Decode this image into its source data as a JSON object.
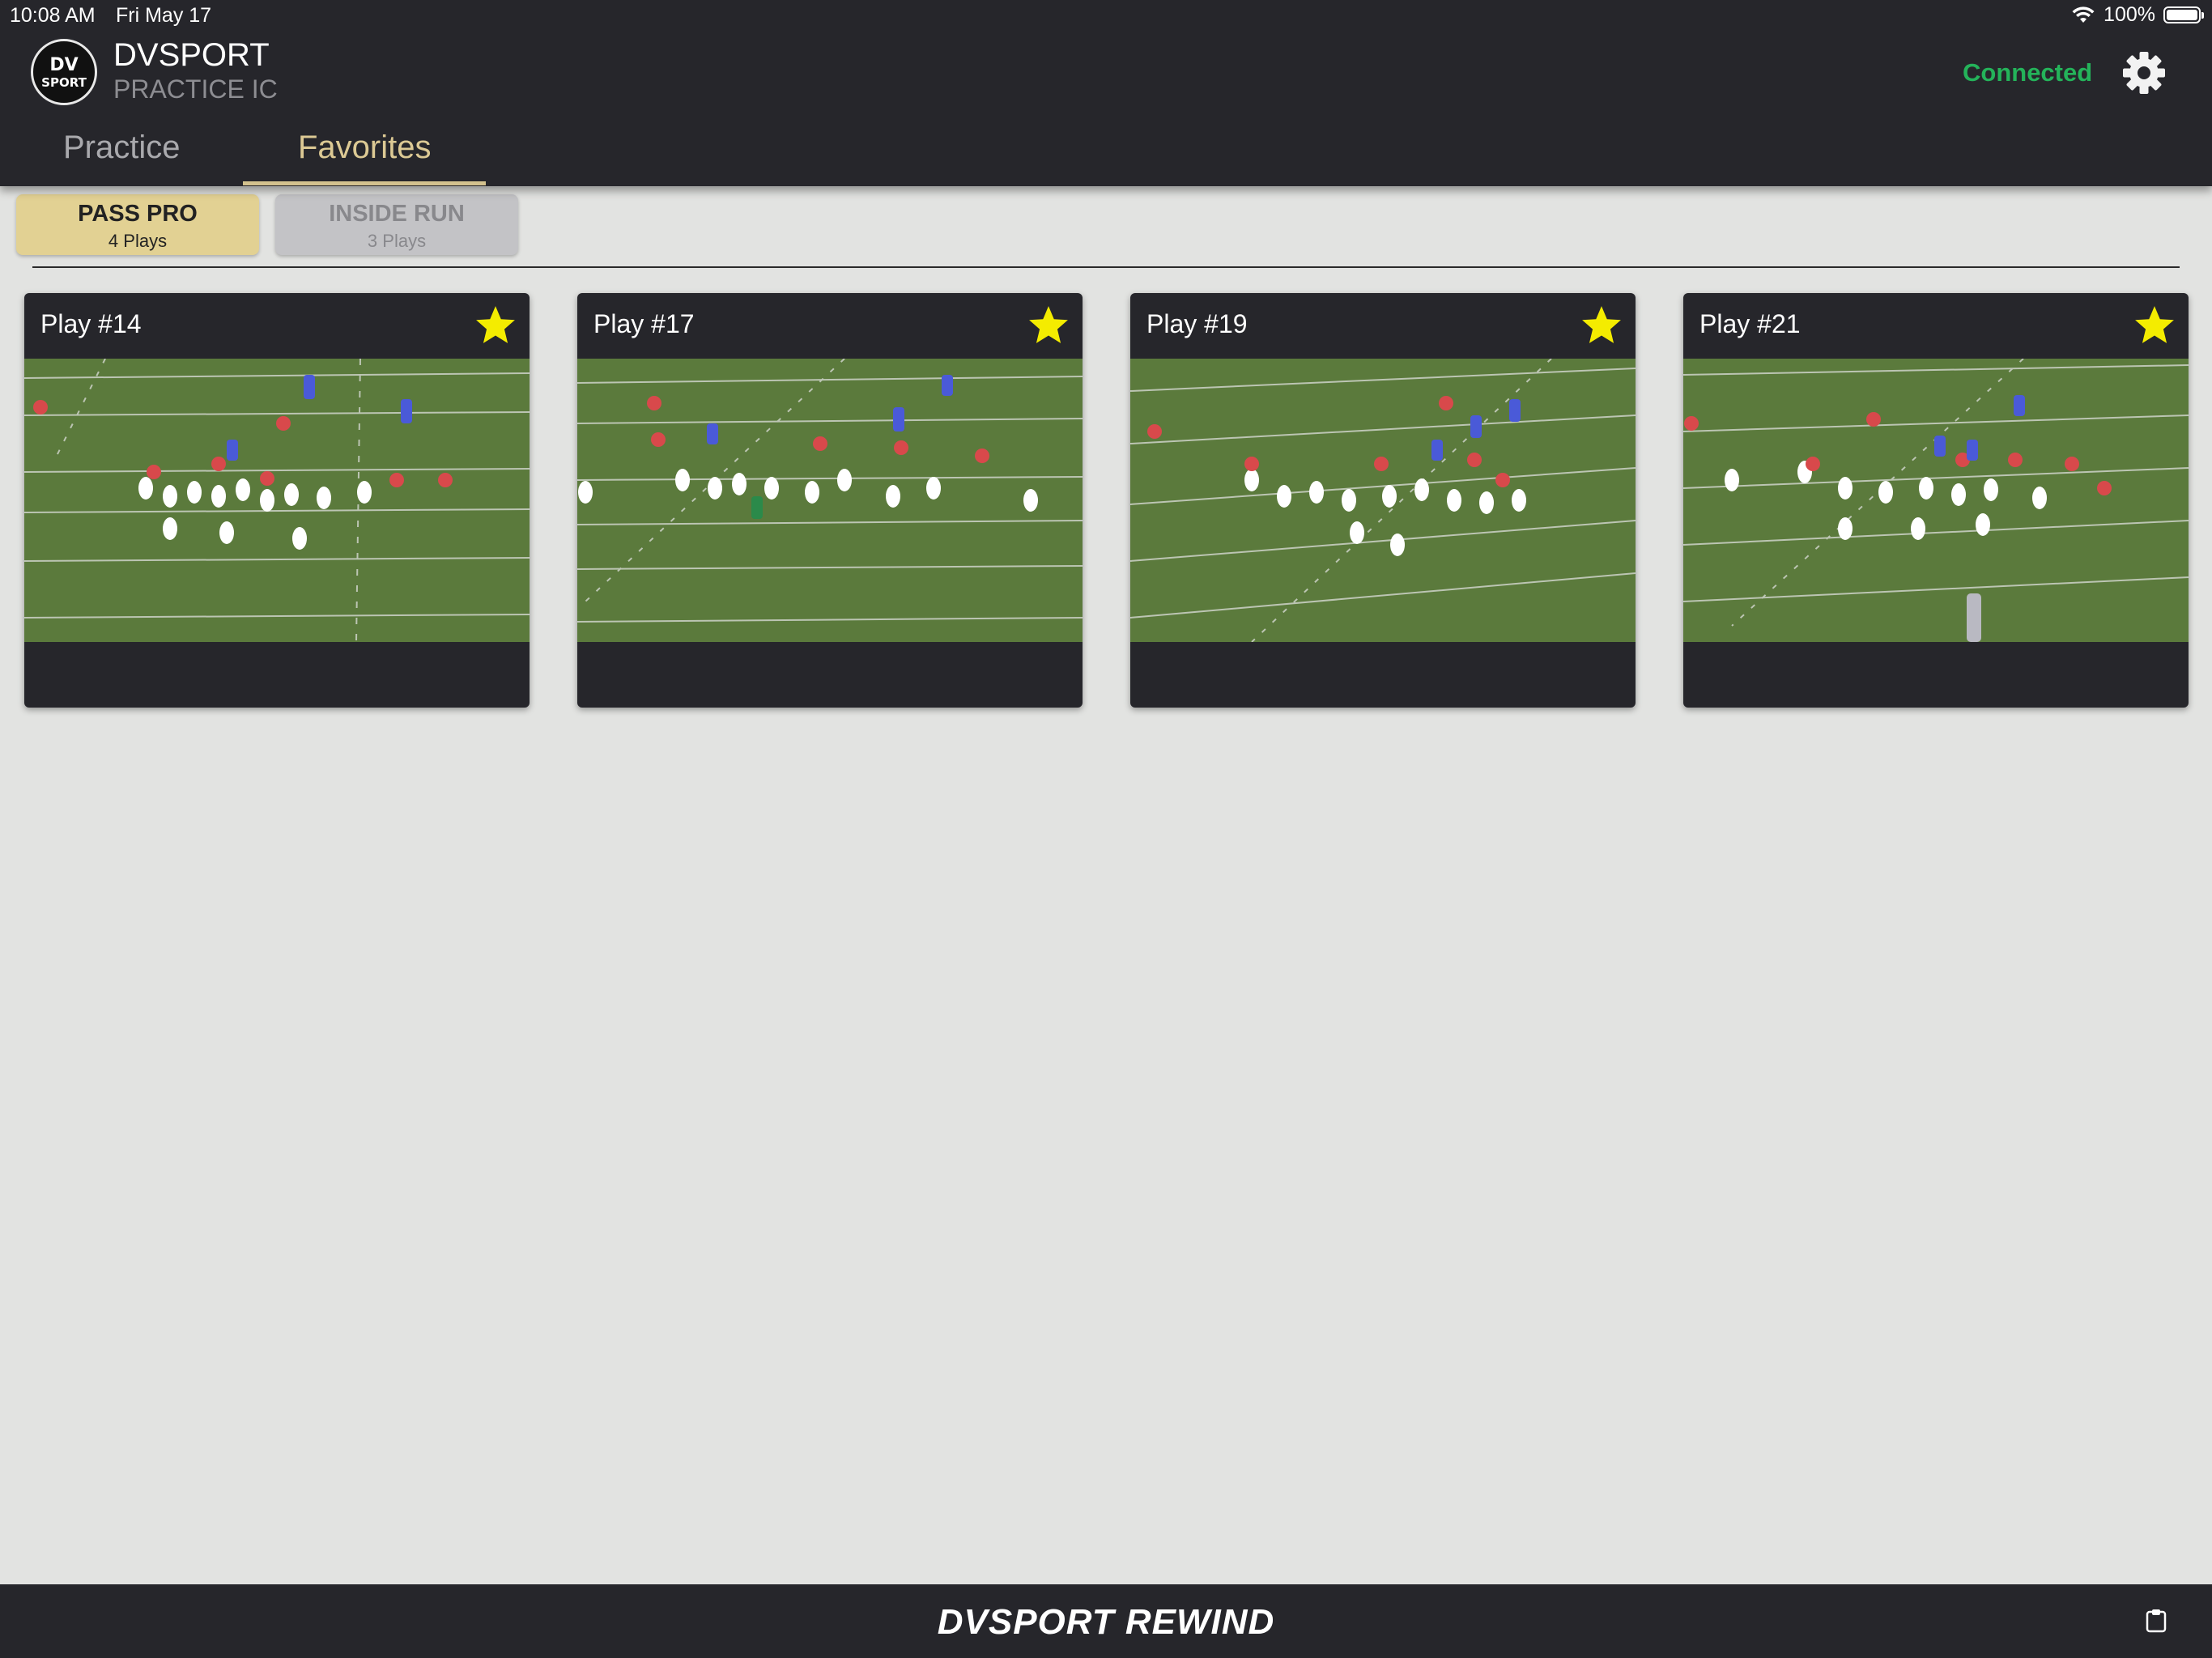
{
  "status_bar": {
    "time": "10:08 AM",
    "date": "Fri May 17",
    "battery_text": "100%"
  },
  "header": {
    "logo_text_top": "DV",
    "logo_text_bottom": "SPORT",
    "title": "DVSPORT",
    "subtitle": "PRACTICE IC",
    "connection_status": "Connected",
    "connection_color": "#24b35a"
  },
  "tabs": [
    {
      "label": "Practice",
      "active": false
    },
    {
      "label": "Favorites",
      "active": true
    }
  ],
  "groups": [
    {
      "name": "PASS PRO",
      "count": "4 Plays",
      "active": true
    },
    {
      "name": "INSIDE RUN",
      "count": "3 Plays",
      "active": false
    }
  ],
  "plays": [
    {
      "title": "Play #14",
      "favorite": true
    },
    {
      "title": "Play #17",
      "favorite": true
    },
    {
      "title": "Play #19",
      "favorite": true
    },
    {
      "title": "Play #21",
      "favorite": true
    }
  ],
  "footer": {
    "brand": "DVSPORT REWIND"
  },
  "colors": {
    "accent": "#dcc994",
    "star": "#f4ec00",
    "field": "#5b7a3c"
  }
}
